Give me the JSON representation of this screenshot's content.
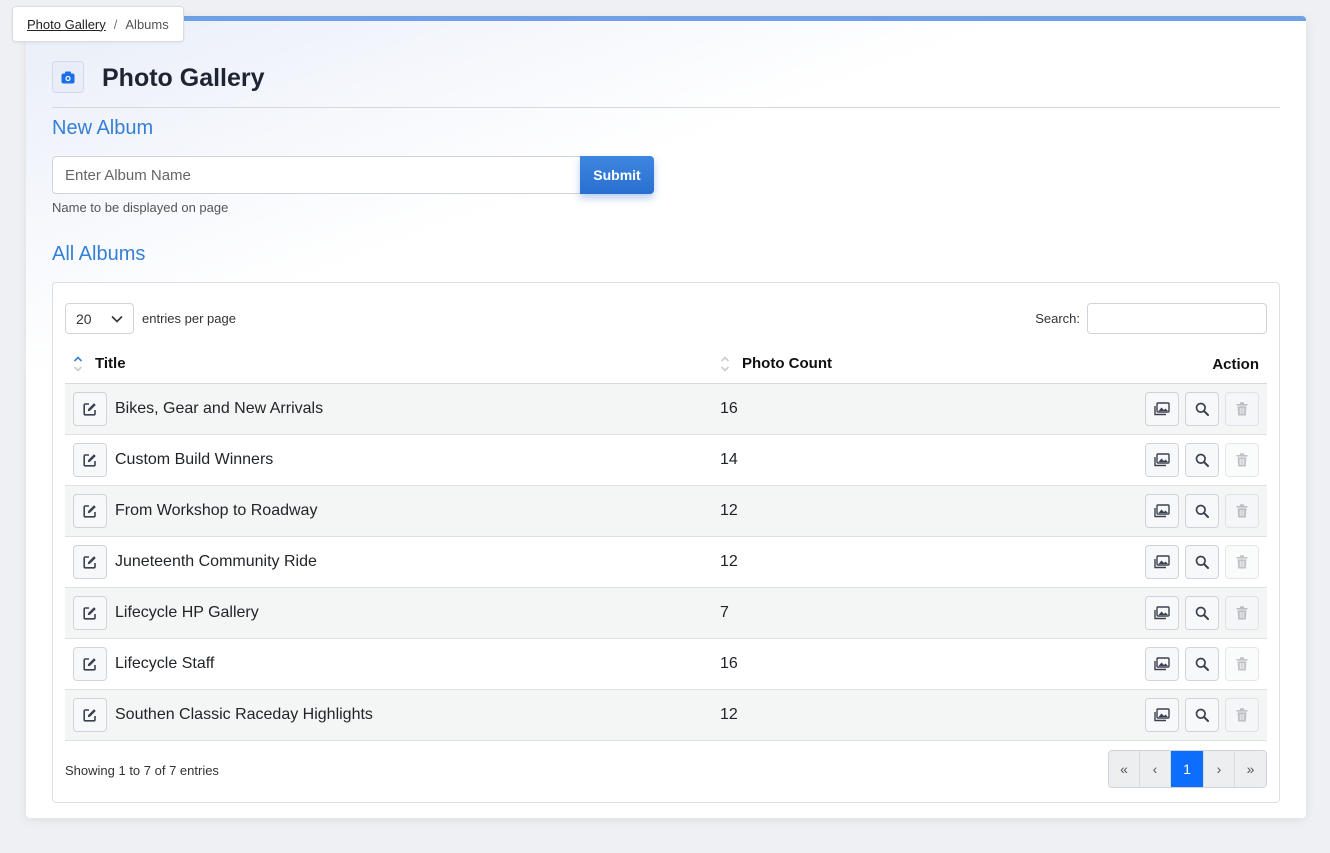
{
  "breadcrumb": {
    "root": "Photo Gallery",
    "current": "Albums"
  },
  "header": {
    "title": "Photo Gallery"
  },
  "new_album": {
    "section_title": "New Album",
    "input_placeholder": "Enter Album Name",
    "input_value": "",
    "submit_label": "Submit",
    "help_text": "Name to be displayed on page"
  },
  "albums": {
    "section_title": "All Albums",
    "entries_per_page_value": "20",
    "entries_per_page_label": "entries per page",
    "search_label": "Search:",
    "search_value": "",
    "columns": {
      "title": "Title",
      "count": "Photo Count",
      "action": "Action"
    },
    "rows": [
      {
        "title": "Bikes, Gear and New Arrivals",
        "count": "16"
      },
      {
        "title": "Custom Build Winners",
        "count": "14"
      },
      {
        "title": "From Workshop to Roadway",
        "count": "12"
      },
      {
        "title": "Juneteenth Community Ride",
        "count": "12"
      },
      {
        "title": "Lifecycle HP Gallery",
        "count": "7"
      },
      {
        "title": "Lifecycle Staff",
        "count": "16"
      },
      {
        "title": "Southen Classic Raceday Highlights",
        "count": "12"
      }
    ],
    "showing_text": "Showing 1 to 7 of 7 entries",
    "pagination": {
      "first": "«",
      "prev": "‹",
      "current": "1",
      "next": "›",
      "last": "»"
    }
  },
  "colors": {
    "accent": "#3580d6",
    "primary_button": "#2a6fd0",
    "active_page": "#0d6efd",
    "top_border": "#6f9fe6"
  },
  "icons": [
    "camera-icon",
    "chevron-down-icon",
    "sort-icon",
    "edit-icon",
    "photos-icon",
    "search-icon",
    "trash-icon"
  ]
}
